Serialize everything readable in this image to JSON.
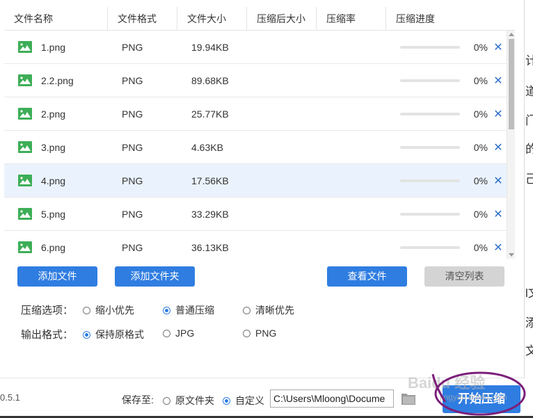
{
  "columns": [
    "文件名称",
    "文件格式",
    "文件大小",
    "压缩后大小",
    "压缩率",
    "压缩进度"
  ],
  "files": [
    {
      "name": "1.png",
      "format": "PNG",
      "size": "19.94KB",
      "after": "",
      "rate": "",
      "progress": 0,
      "progress_text": "0%"
    },
    {
      "name": "2.2.png",
      "format": "PNG",
      "size": "89.68KB",
      "after": "",
      "rate": "",
      "progress": 0,
      "progress_text": "0%"
    },
    {
      "name": "2.png",
      "format": "PNG",
      "size": "25.77KB",
      "after": "",
      "rate": "",
      "progress": 0,
      "progress_text": "0%"
    },
    {
      "name": "3.png",
      "format": "PNG",
      "size": "4.63KB",
      "after": "",
      "rate": "",
      "progress": 0,
      "progress_text": "0%"
    },
    {
      "name": "4.png",
      "format": "PNG",
      "size": "17.56KB",
      "after": "",
      "rate": "",
      "progress": 0,
      "progress_text": "0%",
      "selected": true
    },
    {
      "name": "5.png",
      "format": "PNG",
      "size": "33.29KB",
      "after": "",
      "rate": "",
      "progress": 0,
      "progress_text": "0%"
    },
    {
      "name": "6.png",
      "format": "PNG",
      "size": "36.13KB",
      "after": "",
      "rate": "",
      "progress": 0,
      "progress_text": "0%"
    }
  ],
  "delete_glyph": "✕",
  "buttons": {
    "add_file": "添加文件",
    "add_folder": "添加文件夹",
    "view_files": "查看文件",
    "clear_list": "清空列表",
    "start": "开始压缩"
  },
  "compress_options": {
    "label": "压缩选项：",
    "choices": [
      "缩小优先",
      "普通压缩",
      "清晰优先"
    ],
    "selected": "普通压缩"
  },
  "output_format": {
    "label": "输出格式：",
    "choices": [
      "保持原格式",
      "JPG",
      "PNG"
    ],
    "selected": "保持原格式"
  },
  "footer": {
    "version": "0.5.1",
    "save_to_label": "保存至:",
    "save_choices": [
      "原文件夹",
      "自定义"
    ],
    "save_selected": "自定义",
    "path_value": "C:\\Users\\Mloong\\Docume"
  },
  "watermark": {
    "main": "Baidu 经验",
    "sub": "jingyan.baidu.com"
  },
  "side_fragments": [
    "计",
    "道",
    "门",
    "的",
    "己",
    "（",
    "l文",
    "添",
    "文"
  ],
  "colors": {
    "accent": "#2f7de1",
    "selected_row": "#eaf3fd",
    "icon_green": "#3dae57",
    "annotation": "#7b1f7a"
  },
  "icons": {
    "file": "image-file-icon",
    "delete": "close-icon",
    "folder": "folder-icon"
  }
}
